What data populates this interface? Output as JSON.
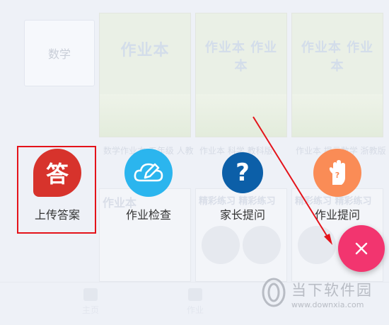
{
  "background": {
    "side_tab_label": "数学",
    "books": [
      {
        "title": "作业本",
        "caption": "数学作业本 五年级 人教"
      },
      {
        "title": "作业本 作业本",
        "caption": "作业本 科学 教科版"
      },
      {
        "title": "作业本 作业本",
        "caption": "作业本 提示数学 浙教版"
      }
    ],
    "row2": [
      {
        "title": "作业本"
      },
      {
        "title": "精彩练习 精彩练习"
      },
      {
        "title": "精彩练习 精彩练习"
      }
    ],
    "nav": [
      "主页",
      "作业"
    ]
  },
  "actions": [
    {
      "label": "上传答案",
      "icon": "answer-icon",
      "color": "#d7332c",
      "glyph": "答"
    },
    {
      "label": "作业检查",
      "icon": "cloud-pencil-icon",
      "color": "#2bb5ee"
    },
    {
      "label": "家长提问",
      "icon": "question-icon",
      "color": "#0c5fa8",
      "glyph": "?"
    },
    {
      "label": "作业提问",
      "icon": "raised-hand-icon",
      "color": "#fa8c56"
    }
  ],
  "fab": {
    "icon": "close-icon",
    "color": "#f2356f"
  },
  "watermark": {
    "text": "当下软件园",
    "url": "www.downxia.com"
  }
}
